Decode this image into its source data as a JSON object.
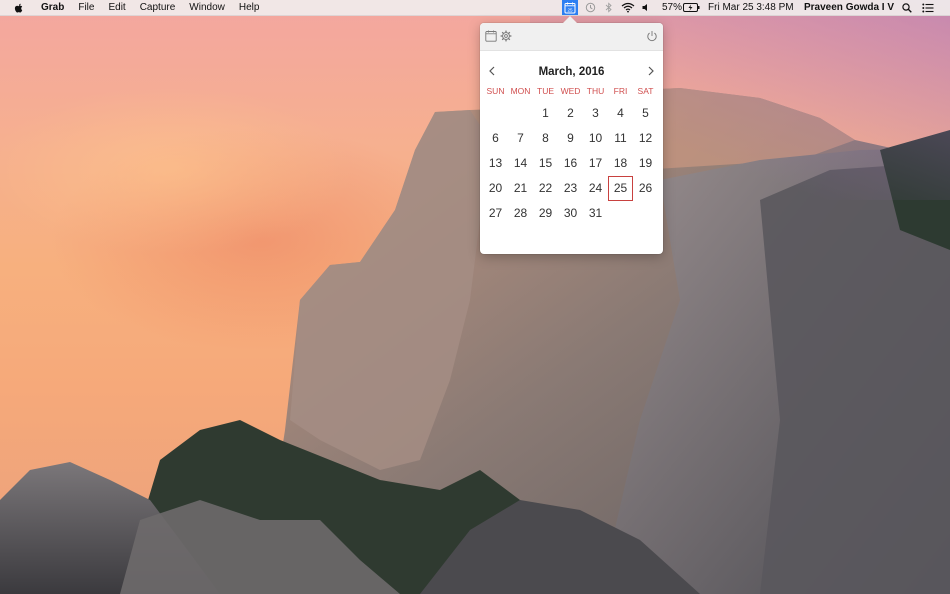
{
  "menubar": {
    "app_name": "Grab",
    "menus": [
      "File",
      "Edit",
      "Capture",
      "Window",
      "Help"
    ],
    "battery": "57%",
    "datetime": "Fri Mar 25  3:48 PM",
    "user": "Praveen Gowda I V",
    "calendar_icon_day": "25",
    "icons": [
      "apple-icon",
      "calendar-status-icon",
      "time-machine-icon",
      "bluetooth-icon",
      "wifi-icon",
      "volume-icon",
      "battery-icon",
      "spotlight-icon",
      "notification-center-icon"
    ]
  },
  "calendar": {
    "month_title": "March, 2016",
    "weekdays": [
      "SUN",
      "MON",
      "TUE",
      "WED",
      "THU",
      "FRI",
      "SAT"
    ],
    "weeks": [
      [
        "",
        "",
        "1",
        "2",
        "3",
        "4",
        "5"
      ],
      [
        "6",
        "7",
        "8",
        "9",
        "10",
        "11",
        "12"
      ],
      [
        "13",
        "14",
        "15",
        "16",
        "17",
        "18",
        "19"
      ],
      [
        "20",
        "21",
        "22",
        "23",
        "24",
        "25",
        "26"
      ],
      [
        "27",
        "28",
        "29",
        "30",
        "31",
        "",
        ""
      ]
    ],
    "today": "25",
    "accent_color": "#c8413f",
    "weekday_color": "#d04e4e",
    "toolbar_icons": [
      "calendar-icon",
      "gear-icon",
      "power-icon"
    ],
    "nav_icons": [
      "chevron-left-icon",
      "chevron-right-icon"
    ]
  }
}
